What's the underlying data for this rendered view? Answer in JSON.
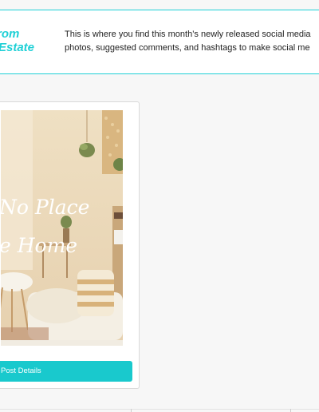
{
  "brand": {
    "line1": "rom",
    "line2": "Estate"
  },
  "description": {
    "line1": "This is where you find this month’s newly released social media",
    "line2": "photos, suggested comments, and hashtags to make social me"
  },
  "post_card": {
    "image_text_line1": "No Place",
    "image_text_line2": "e Home",
    "view_button_label": "Post Details"
  },
  "colors": {
    "accent": "#1fd0d6",
    "button": "#19c9cd"
  }
}
